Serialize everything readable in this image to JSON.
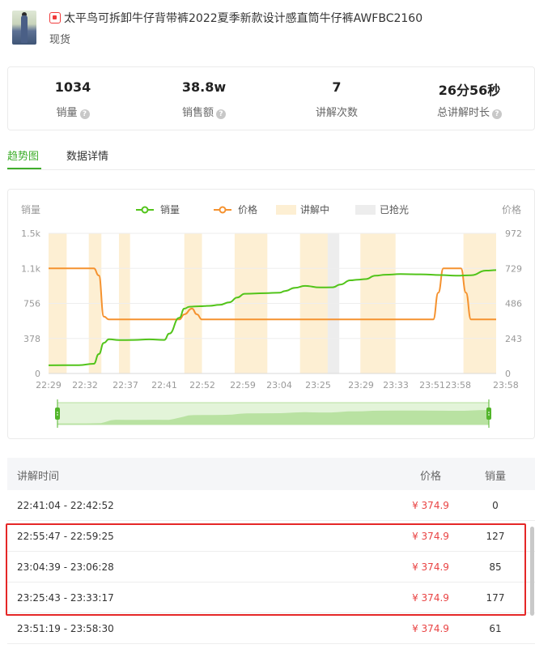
{
  "product": {
    "title": "太平鸟可拆卸牛仔背带裤2022夏季新款设计感直筒牛仔裤AWFBC2160",
    "status": "现货",
    "shop_icon": "shop-icon"
  },
  "stats": [
    {
      "value": "1034",
      "label": "销量"
    },
    {
      "value": "38.8w",
      "label": "销售额"
    },
    {
      "value": "7",
      "label": "讲解次数"
    },
    {
      "value": "26分56秒",
      "label": "总讲解时长"
    }
  ],
  "tabs": [
    {
      "label": "趋势图",
      "active": true
    },
    {
      "label": "数据详情",
      "active": false
    }
  ],
  "chart_data": {
    "type": "line",
    "y_left_label": "销量",
    "y_right_label": "价格",
    "legend": [
      {
        "name": "销量",
        "color": "#52c41a",
        "kind": "line"
      },
      {
        "name": "价格",
        "color": "#f5922f",
        "kind": "line"
      },
      {
        "name": "讲解中",
        "color": "#fdefd3",
        "kind": "area"
      },
      {
        "name": "已抢光",
        "color": "#ededed",
        "kind": "area"
      }
    ],
    "y_left_ticks": [
      "0",
      "378",
      "756",
      "1.1k",
      "1.5k"
    ],
    "y_left_range": [
      0,
      1512
    ],
    "y_right_ticks": [
      "0",
      "243",
      "486",
      "729",
      "972"
    ],
    "y_right_range": [
      0,
      972
    ],
    "x_ticks": [
      "22:29",
      "22:32",
      "22:37",
      "22:41",
      "22:52",
      "22:59",
      "23:04",
      "23:25",
      "23:29",
      "23:33",
      "23:51",
      "23:58",
      "23:58"
    ],
    "x_range": [
      0,
      89
    ],
    "explaining_ranges": [
      [
        0,
        3.6
      ],
      [
        8,
        10.5
      ],
      [
        14,
        16.2
      ],
      [
        27,
        30.5
      ],
      [
        37,
        43.5
      ],
      [
        50,
        56.2
      ],
      [
        62,
        69
      ],
      [
        82.5,
        89
      ]
    ],
    "sold_out_ranges": [
      [
        55.5,
        57.8
      ]
    ],
    "sales": [
      [
        0,
        88
      ],
      [
        6,
        90
      ],
      [
        9,
        105
      ],
      [
        10,
        210
      ],
      [
        11,
        330
      ],
      [
        12,
        370
      ],
      [
        14,
        360
      ],
      [
        17,
        362
      ],
      [
        20,
        368
      ],
      [
        23,
        362
      ],
      [
        24,
        430
      ],
      [
        26,
        600
      ],
      [
        27,
        700
      ],
      [
        28,
        720
      ],
      [
        30,
        725
      ],
      [
        32,
        730
      ],
      [
        34,
        740
      ],
      [
        36,
        768
      ],
      [
        37.5,
        820
      ],
      [
        39,
        860
      ],
      [
        43,
        866
      ],
      [
        46,
        872
      ],
      [
        47,
        890
      ],
      [
        49,
        925
      ],
      [
        51,
        945
      ],
      [
        54,
        928
      ],
      [
        56.5,
        930
      ],
      [
        58,
        960
      ],
      [
        60,
        1005
      ],
      [
        61.5,
        1012
      ],
      [
        63,
        1018
      ],
      [
        65,
        1055
      ],
      [
        67,
        1065
      ],
      [
        70,
        1072
      ],
      [
        74,
        1070
      ],
      [
        78,
        1062
      ],
      [
        81,
        1055
      ],
      [
        84,
        1060
      ],
      [
        87,
        1110
      ],
      [
        89,
        1115
      ]
    ],
    "price": [
      [
        0,
        729
      ],
      [
        9,
        729
      ],
      [
        10,
        680
      ],
      [
        11,
        395
      ],
      [
        12,
        375
      ],
      [
        18,
        375
      ],
      [
        26,
        375
      ],
      [
        27,
        410
      ],
      [
        28.5,
        450
      ],
      [
        29.5,
        410
      ],
      [
        30.5,
        375
      ],
      [
        36,
        375
      ],
      [
        44,
        375
      ],
      [
        56,
        375
      ],
      [
        72,
        375
      ],
      [
        76.5,
        375
      ],
      [
        77.5,
        560
      ],
      [
        78.5,
        729
      ],
      [
        82,
        729
      ],
      [
        83,
        560
      ],
      [
        84,
        375
      ],
      [
        89,
        375
      ]
    ]
  },
  "table": {
    "headers": {
      "time": "讲解时间",
      "price": "价格",
      "sales": "销量"
    },
    "rows": [
      {
        "time": "22:41:04 - 22:42:52",
        "price": "¥ 374.9",
        "sales": "0"
      },
      {
        "time": "22:55:47 - 22:59:25",
        "price": "¥ 374.9",
        "sales": "127"
      },
      {
        "time": "23:04:39 - 23:06:28",
        "price": "¥ 374.9",
        "sales": "85"
      },
      {
        "time": "23:25:43 - 23:33:17",
        "price": "¥ 374.9",
        "sales": "177"
      },
      {
        "time": "23:51:19 - 23:58:30",
        "price": "¥ 374.9",
        "sales": "61"
      }
    ]
  },
  "colors": {
    "accent": "#3fae2b",
    "price_text": "#e94343",
    "highlight_border": "#e52727"
  }
}
